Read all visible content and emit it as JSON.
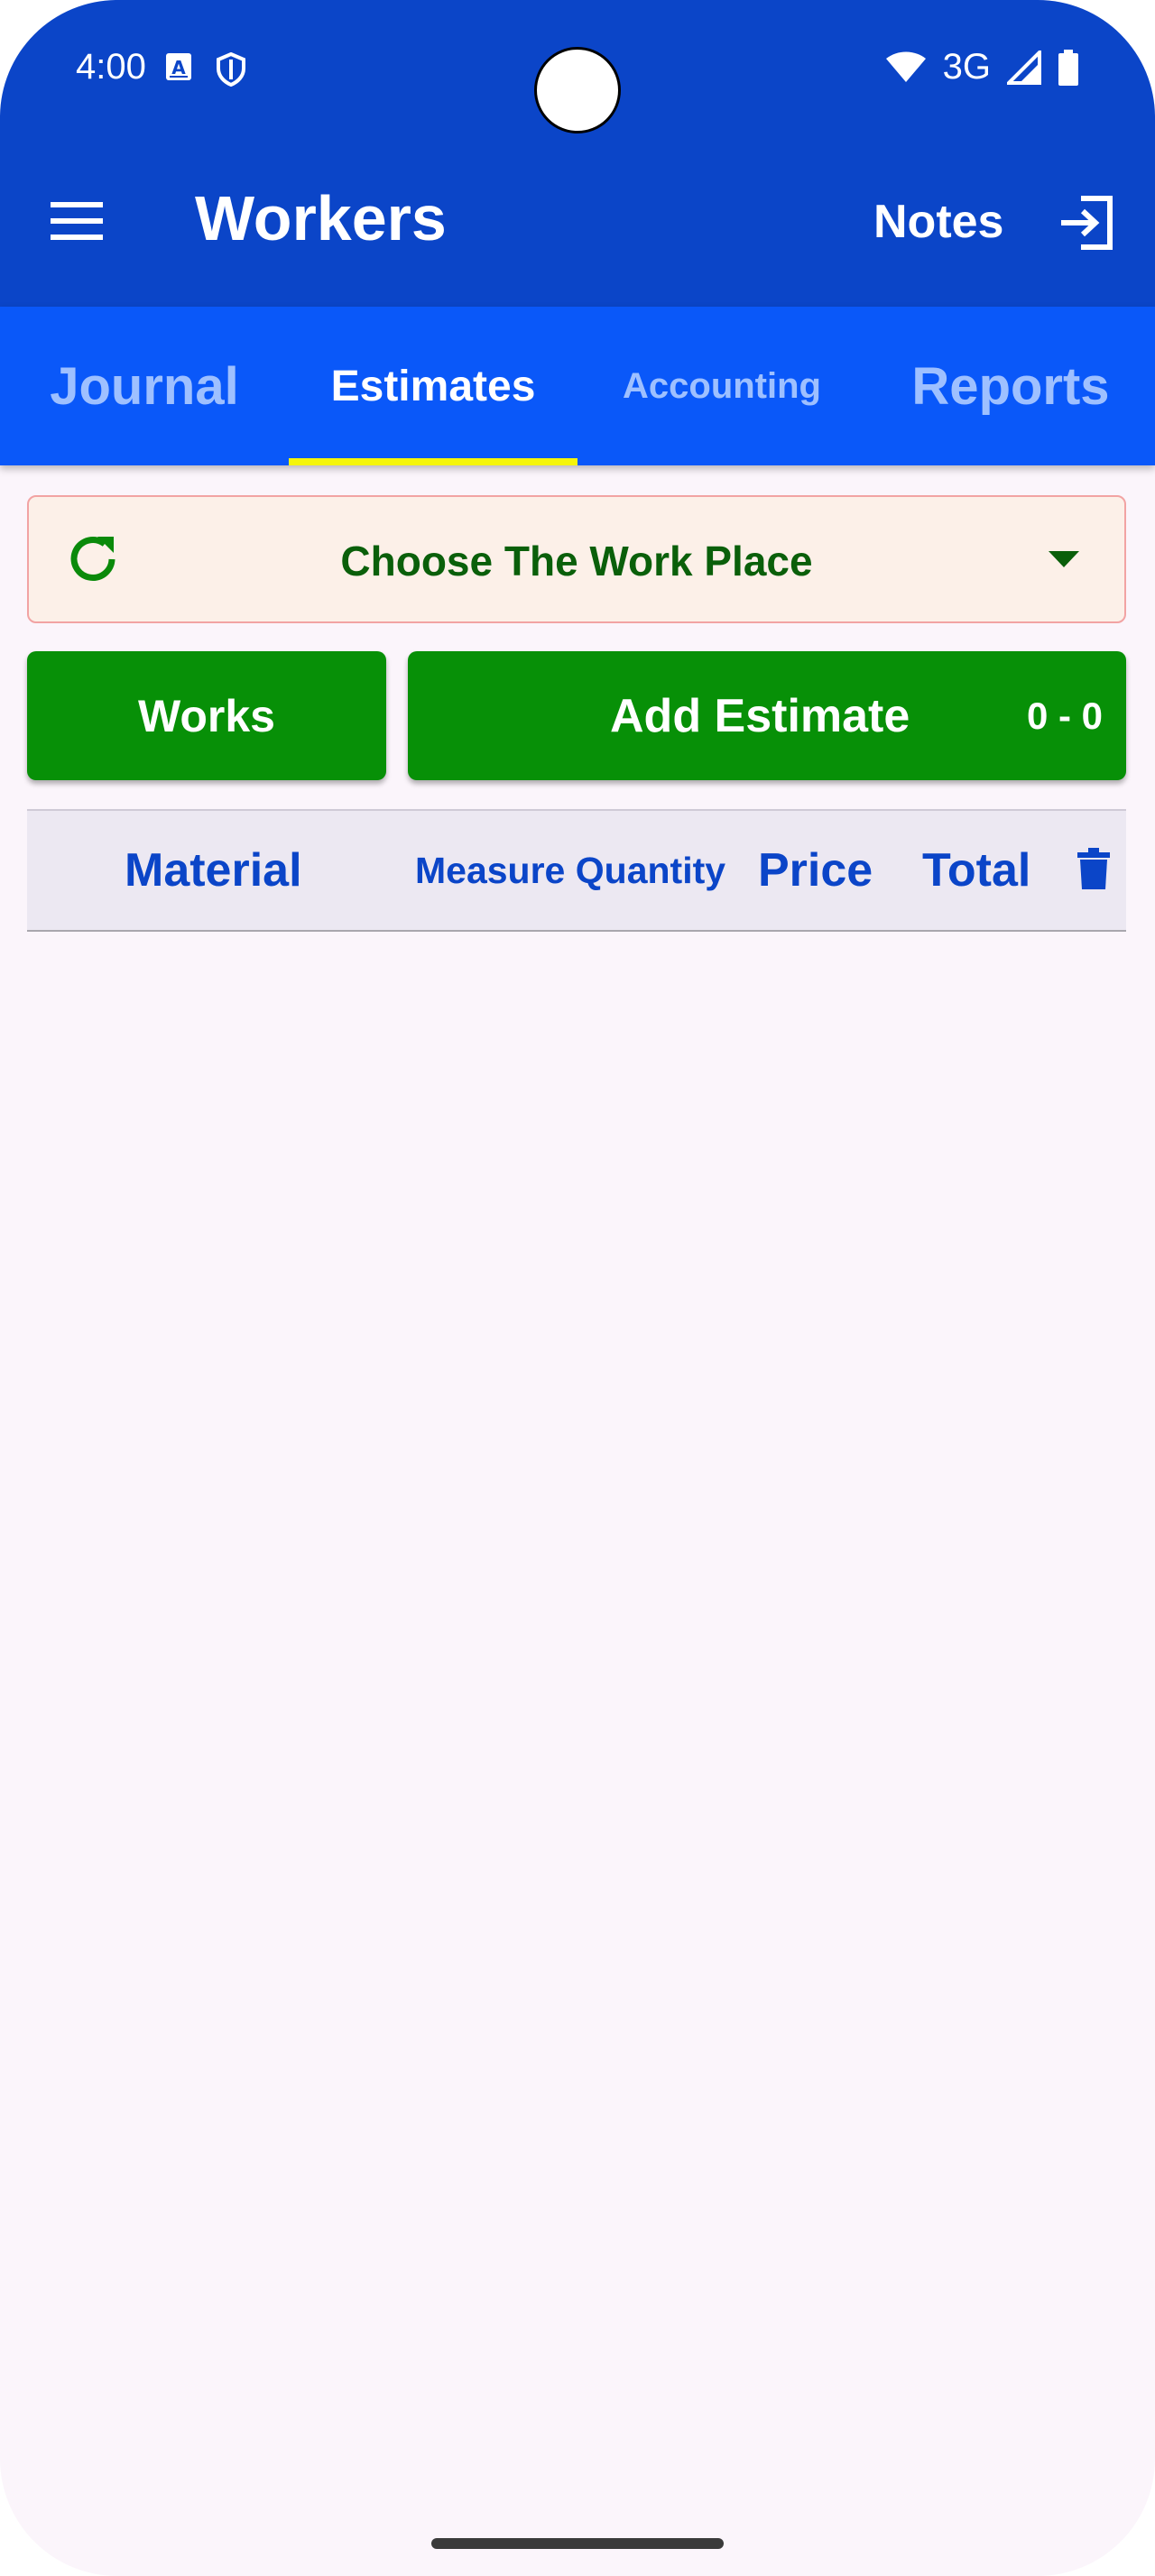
{
  "status_bar": {
    "time": "4:00",
    "network": "3G",
    "icons": [
      "font-a-icon",
      "shield-icon",
      "wifi-icon",
      "signal-icon",
      "battery-icon"
    ]
  },
  "app_bar": {
    "title": "Workers",
    "notes_label": "Notes",
    "icons": [
      "hamburger-menu-icon",
      "exit-icon"
    ],
    "color": "#0b45c8"
  },
  "tabs": {
    "items": [
      {
        "label": "Journal",
        "active": false
      },
      {
        "label": "Estimates",
        "active": true
      },
      {
        "label": "Accounting",
        "active": false
      },
      {
        "label": "Reports",
        "active": false
      }
    ],
    "background": "#0a58f9",
    "indicator_color": "#f5f50a"
  },
  "workplace_selector": {
    "label": "Choose The Work Place",
    "icons": [
      "refresh-icon",
      "dropdown-arrow-icon"
    ]
  },
  "actions": {
    "works_label": "Works",
    "add_estimate_label": "Add Estimate",
    "count_label": "0 - 0",
    "button_color": "#079007"
  },
  "table": {
    "columns": [
      "Material",
      "Measure Quantity",
      "Price",
      "Total"
    ],
    "delete_icon": "trash-icon",
    "rows": []
  }
}
